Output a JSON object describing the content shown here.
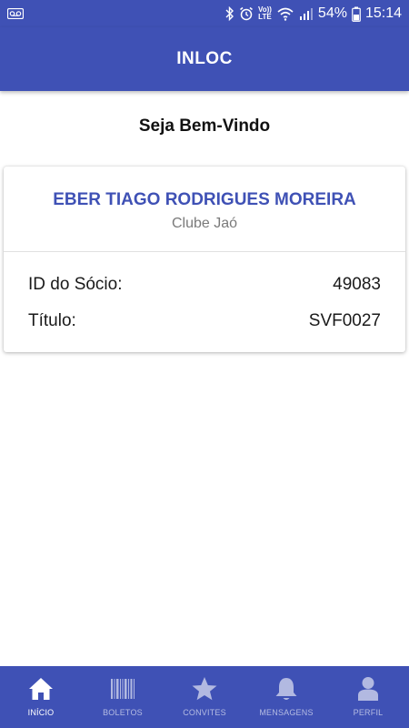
{
  "status_bar": {
    "volte_line1": "Vo))",
    "volte_line2": "LTE",
    "battery": "54%",
    "time": "15:14",
    "icons": [
      "voicemail-icon",
      "bluetooth-icon",
      "alarm-icon",
      "volte-icon",
      "wifi-icon",
      "signal-icon",
      "battery-icon"
    ]
  },
  "app_bar": {
    "title": "INLOC"
  },
  "welcome": "Seja Bem-Vindo",
  "member_card": {
    "name": "EBER TIAGO RODRIGUES MOREIRA",
    "club": "Clube Jaó",
    "rows": [
      {
        "label": "ID do Sócio:",
        "value": "49083"
      },
      {
        "label": "Título:",
        "value": "SVF0027"
      }
    ]
  },
  "bottom_nav": {
    "items": [
      {
        "label": "INÍCIO",
        "icon": "home-icon",
        "active": true
      },
      {
        "label": "BOLETOS",
        "icon": "barcode-icon",
        "active": false
      },
      {
        "label": "CONVITES",
        "icon": "star-icon",
        "active": false
      },
      {
        "label": "MENSAGENS",
        "icon": "bell-icon",
        "active": false
      },
      {
        "label": "PERFIL",
        "icon": "person-icon",
        "active": false
      }
    ]
  },
  "colors": {
    "primary": "#3f51b5",
    "accent_text": "#3f51b5",
    "secondary_text": "#7a7a7a",
    "background": "#ffffff"
  }
}
